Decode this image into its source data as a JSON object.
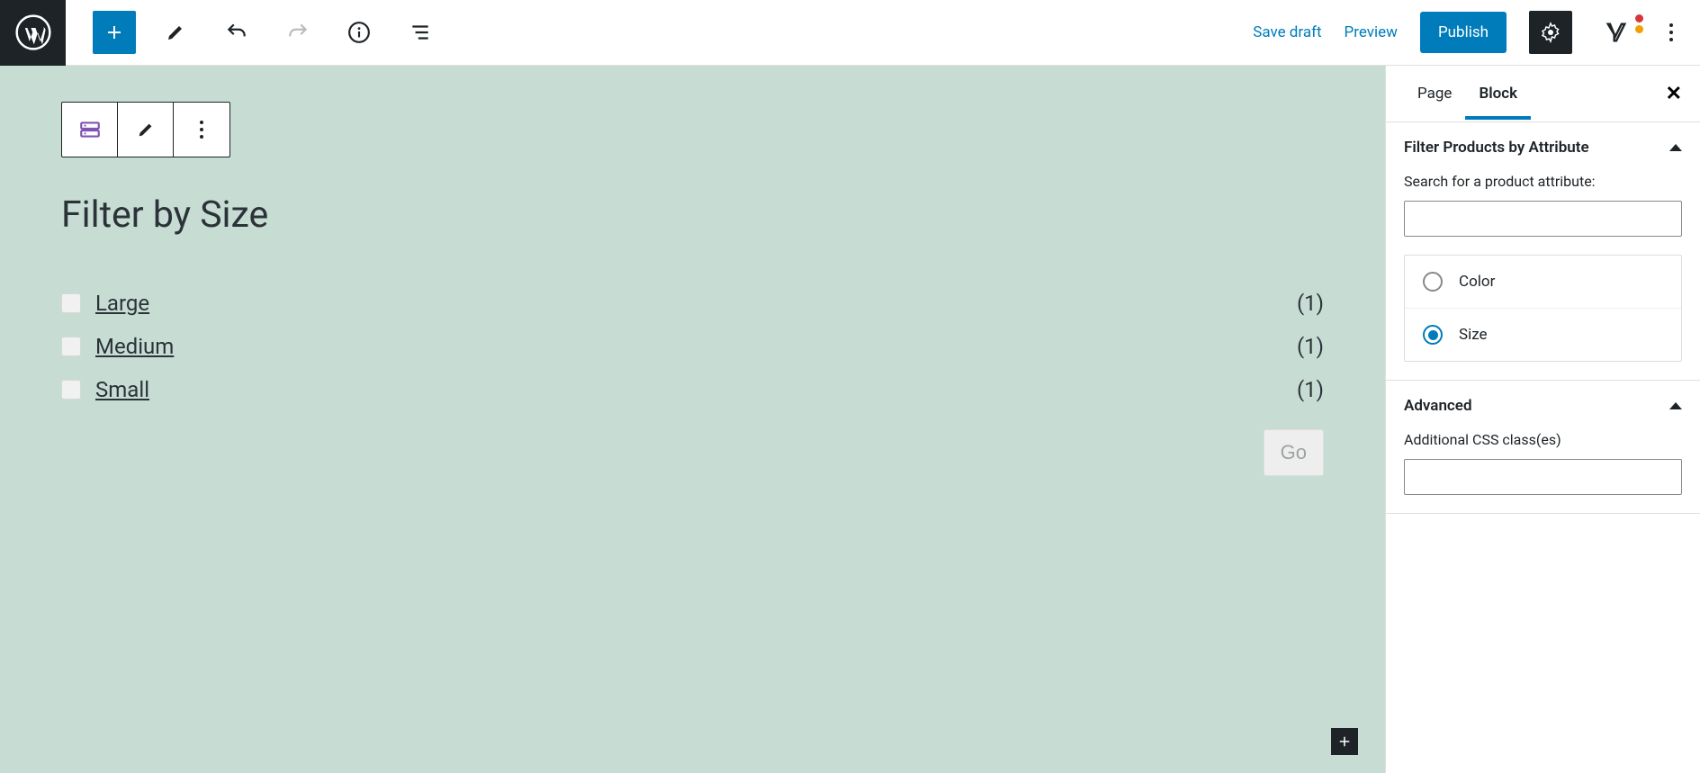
{
  "topbar": {
    "save_draft": "Save draft",
    "preview": "Preview",
    "publish": "Publish"
  },
  "block": {
    "title": "Filter by Size",
    "go_label": "Go",
    "items": [
      {
        "label": "Large",
        "count": "(1)"
      },
      {
        "label": "Medium",
        "count": "(1)"
      },
      {
        "label": "Small",
        "count": "(1)"
      }
    ]
  },
  "sidebar": {
    "tabs": {
      "page": "Page",
      "block": "Block"
    },
    "panel_filter": {
      "title": "Filter Products by Attribute",
      "search_label": "Search for a product attribute:",
      "search_value": "",
      "attributes": [
        {
          "label": "Color",
          "selected": false
        },
        {
          "label": "Size",
          "selected": true
        }
      ]
    },
    "panel_advanced": {
      "title": "Advanced",
      "css_label": "Additional CSS class(es)",
      "css_value": ""
    }
  }
}
